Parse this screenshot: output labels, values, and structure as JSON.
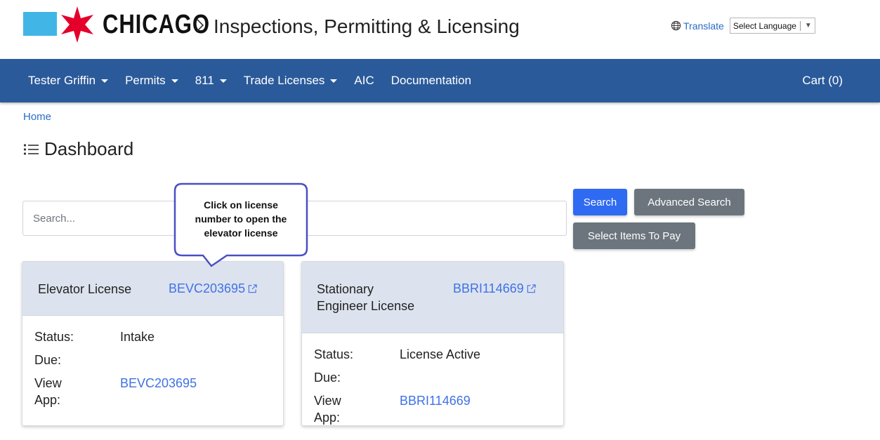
{
  "header": {
    "logo_text": "CHICAGO",
    "site_title": "Inspections, Permitting & Licensing",
    "translate_label": "Translate",
    "language_select": "Select Language"
  },
  "nav": {
    "items": [
      {
        "label": "Tester Griffin",
        "dropdown": true
      },
      {
        "label": "Permits",
        "dropdown": true
      },
      {
        "label": "811",
        "dropdown": true
      },
      {
        "label": "Trade Licenses",
        "dropdown": true
      },
      {
        "label": "AIC",
        "dropdown": false
      },
      {
        "label": "Documentation",
        "dropdown": false
      }
    ],
    "cart": "Cart (0)"
  },
  "breadcrumb": "Home",
  "page_title": "Dashboard",
  "search": {
    "placeholder": "Search...",
    "search_button": "Search",
    "advanced_button": "Advanced Search",
    "pay_button": "Select Items To Pay"
  },
  "callout": {
    "lines": [
      "Click on license",
      "number to open the",
      "elevator license"
    ]
  },
  "cards": [
    {
      "title": "Elevator License",
      "license_number": "BEVC203695",
      "status_label": "Status:",
      "status_value": "Intake",
      "due_label": "Due:",
      "due_value": "",
      "view_label": "View App:",
      "view_value": "BEVC203695"
    },
    {
      "title": "Stationary Engineer License",
      "license_number": "BBRI114669",
      "status_label": "Status:",
      "status_value": "License Active",
      "due_label": "Due:",
      "due_value": "",
      "view_label": "View App:",
      "view_value": "BBRI114669"
    }
  ],
  "colors": {
    "nav_bg": "#2a5a9a",
    "link": "#3f72e6",
    "primary_button": "#2f6af2",
    "secondary_button": "#6c757d",
    "card_header_bg": "#dde3ee",
    "logo_blue": "#41b6e6",
    "logo_red": "#e4002b"
  }
}
